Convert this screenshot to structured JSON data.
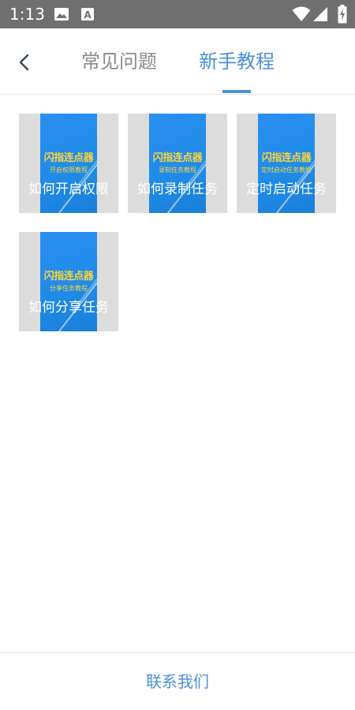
{
  "status_bar": {
    "time": "1:13",
    "icons": [
      "image-icon",
      "font-download-icon",
      "wifi-icon",
      "signal-icon",
      "battery-charging-icon"
    ]
  },
  "header": {
    "back_icon": "chevron-left-icon",
    "tabs": [
      {
        "label": "常见问题",
        "active": false
      },
      {
        "label": "新手教程",
        "active": true
      }
    ],
    "accent_color": "#4a90d9",
    "inactive_color": "#8a8a8a"
  },
  "tutorials": [
    {
      "title": "如何开启权限",
      "thumb_brand": "闪指连点器",
      "thumb_sub": "开启权限教程"
    },
    {
      "title": "如何录制任务",
      "thumb_brand": "闪指连点器",
      "thumb_sub": "录制任务教程"
    },
    {
      "title": "定时启动任务",
      "thumb_brand": "闪指连点器",
      "thumb_sub": "定时启动任务教程"
    },
    {
      "title": "如何分享任务",
      "thumb_brand": "闪指连点器",
      "thumb_sub": "分享任务教程"
    }
  ],
  "footer": {
    "contact_label": "联系我们"
  }
}
